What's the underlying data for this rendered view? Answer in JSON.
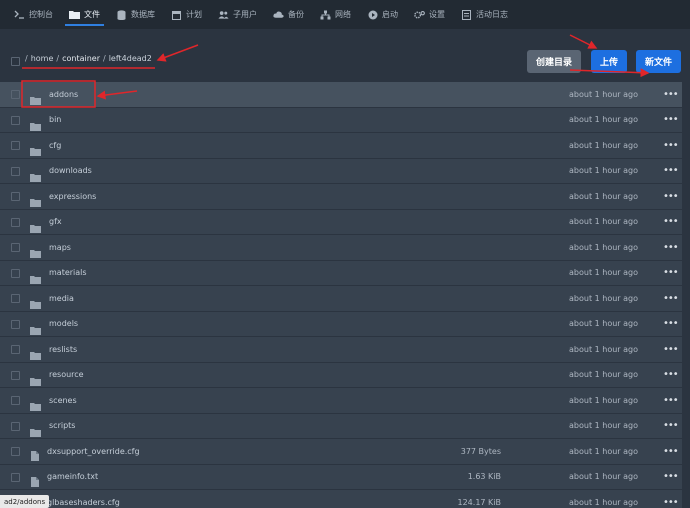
{
  "nav": {
    "items": [
      {
        "label": "控制台",
        "icon": "terminal-icon"
      },
      {
        "label": "文件",
        "icon": "folder-icon",
        "active": true
      },
      {
        "label": "数据库",
        "icon": "database-icon"
      },
      {
        "label": "计划",
        "icon": "calendar-icon"
      },
      {
        "label": "子用户",
        "icon": "users-icon"
      },
      {
        "label": "备份",
        "icon": "cloud-icon"
      },
      {
        "label": "网络",
        "icon": "network-icon"
      },
      {
        "label": "启动",
        "icon": "play-icon"
      },
      {
        "label": "设置",
        "icon": "gears-icon"
      },
      {
        "label": "活动日志",
        "icon": "log-icon"
      }
    ]
  },
  "breadcrumb": {
    "segments": [
      "home",
      "container",
      "left4dead2"
    ]
  },
  "buttons": {
    "create_dir": "创建目录",
    "upload": "上传",
    "new_file": "新文件"
  },
  "files": [
    {
      "name": "addons",
      "type": "folder",
      "modified": "about 1 hour ago"
    },
    {
      "name": "bin",
      "type": "folder",
      "modified": "about 1 hour ago"
    },
    {
      "name": "cfg",
      "type": "folder",
      "modified": "about 1 hour ago"
    },
    {
      "name": "downloads",
      "type": "folder",
      "modified": "about 1 hour ago"
    },
    {
      "name": "expressions",
      "type": "folder",
      "modified": "about 1 hour ago"
    },
    {
      "name": "gfx",
      "type": "folder",
      "modified": "about 1 hour ago"
    },
    {
      "name": "maps",
      "type": "folder",
      "modified": "about 1 hour ago"
    },
    {
      "name": "materials",
      "type": "folder",
      "modified": "about 1 hour ago"
    },
    {
      "name": "media",
      "type": "folder",
      "modified": "about 1 hour ago"
    },
    {
      "name": "models",
      "type": "folder",
      "modified": "about 1 hour ago"
    },
    {
      "name": "reslists",
      "type": "folder",
      "modified": "about 1 hour ago"
    },
    {
      "name": "resource",
      "type": "folder",
      "modified": "about 1 hour ago"
    },
    {
      "name": "scenes",
      "type": "folder",
      "modified": "about 1 hour ago"
    },
    {
      "name": "scripts",
      "type": "folder",
      "modified": "about 1 hour ago"
    },
    {
      "name": "dxsupport_override.cfg",
      "type": "file",
      "size": "377 Bytes",
      "modified": "about 1 hour ago"
    },
    {
      "name": "gameinfo.txt",
      "type": "file",
      "size": "1.63 KiB",
      "modified": "about 1 hour ago"
    },
    {
      "name": "glbaseshaders.cfg",
      "type": "file",
      "size": "124.17 KiB",
      "modified": "about 1 hour ago"
    }
  ],
  "status_tooltip": "ad2/addons",
  "colors": {
    "accent": "#1d6fe0",
    "annotation": "#e0262a"
  }
}
